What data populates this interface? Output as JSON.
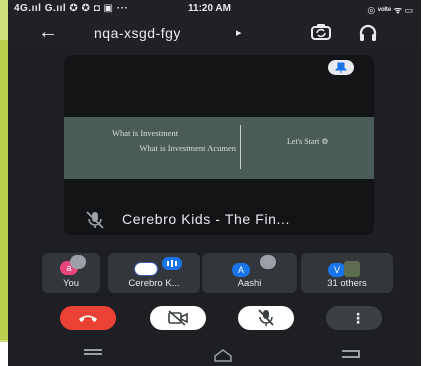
{
  "status_bar": {
    "signal_text": "4G.ııl G.ııl ✪ ✪ ◘ ▣ ···",
    "time": "11:20 AM",
    "right_icons": "◎ ᵛᵒˡᵗᵉ ᯤ ▭"
  },
  "top_bar": {
    "back_glyph": "←",
    "meeting_code": "nqa-xsgd-fgy",
    "caret_glyph": "▸"
  },
  "presentation": {
    "slide_line1": "What is Investment",
    "slide_line2": "What is Investment Acumen",
    "slide_right": "Let's Start ⚙",
    "presenter_label": "Cerebro Kids - The Fin..."
  },
  "participants": [
    {
      "name": "You",
      "avatar_letter": "a",
      "avatar_color": "#e8457b"
    },
    {
      "name": "Cerebro K...",
      "avatar_letter": "",
      "avatar_color": "#ffffff"
    },
    {
      "name": "Aashi",
      "avatar_letter": "A",
      "avatar_color": "#1a73e8"
    },
    {
      "name": "31 others",
      "avatar_letter": "V",
      "avatar_color": "#1a73e8"
    }
  ],
  "controls": {
    "end_call_color": "#ea4335",
    "more_glyph": "⋮"
  },
  "colors": {
    "background": "#1e1f22",
    "tile": "#33363a",
    "slide": "#4b5c58",
    "accent": "#1a73e8"
  }
}
